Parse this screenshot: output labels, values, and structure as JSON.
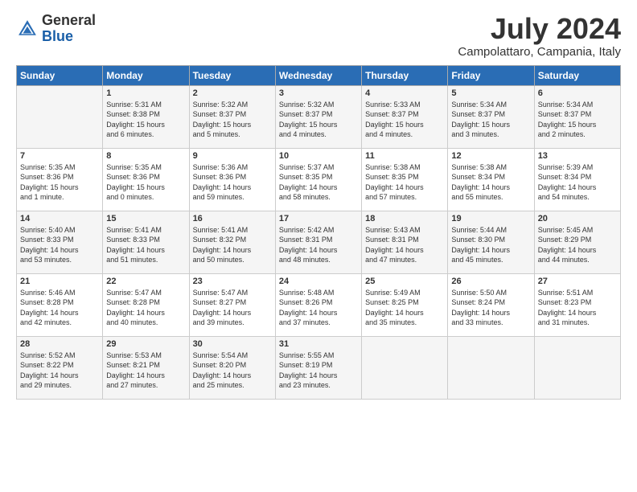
{
  "header": {
    "logo_general": "General",
    "logo_blue": "Blue",
    "month_title": "July 2024",
    "location": "Campolattaro, Campania, Italy"
  },
  "days_of_week": [
    "Sunday",
    "Monday",
    "Tuesday",
    "Wednesday",
    "Thursday",
    "Friday",
    "Saturday"
  ],
  "weeks": [
    [
      {
        "day": "",
        "lines": []
      },
      {
        "day": "1",
        "lines": [
          "Sunrise: 5:31 AM",
          "Sunset: 8:38 PM",
          "Daylight: 15 hours",
          "and 6 minutes."
        ]
      },
      {
        "day": "2",
        "lines": [
          "Sunrise: 5:32 AM",
          "Sunset: 8:37 PM",
          "Daylight: 15 hours",
          "and 5 minutes."
        ]
      },
      {
        "day": "3",
        "lines": [
          "Sunrise: 5:32 AM",
          "Sunset: 8:37 PM",
          "Daylight: 15 hours",
          "and 4 minutes."
        ]
      },
      {
        "day": "4",
        "lines": [
          "Sunrise: 5:33 AM",
          "Sunset: 8:37 PM",
          "Daylight: 15 hours",
          "and 4 minutes."
        ]
      },
      {
        "day": "5",
        "lines": [
          "Sunrise: 5:34 AM",
          "Sunset: 8:37 PM",
          "Daylight: 15 hours",
          "and 3 minutes."
        ]
      },
      {
        "day": "6",
        "lines": [
          "Sunrise: 5:34 AM",
          "Sunset: 8:37 PM",
          "Daylight: 15 hours",
          "and 2 minutes."
        ]
      }
    ],
    [
      {
        "day": "7",
        "lines": [
          "Sunrise: 5:35 AM",
          "Sunset: 8:36 PM",
          "Daylight: 15 hours",
          "and 1 minute."
        ]
      },
      {
        "day": "8",
        "lines": [
          "Sunrise: 5:35 AM",
          "Sunset: 8:36 PM",
          "Daylight: 15 hours",
          "and 0 minutes."
        ]
      },
      {
        "day": "9",
        "lines": [
          "Sunrise: 5:36 AM",
          "Sunset: 8:36 PM",
          "Daylight: 14 hours",
          "and 59 minutes."
        ]
      },
      {
        "day": "10",
        "lines": [
          "Sunrise: 5:37 AM",
          "Sunset: 8:35 PM",
          "Daylight: 14 hours",
          "and 58 minutes."
        ]
      },
      {
        "day": "11",
        "lines": [
          "Sunrise: 5:38 AM",
          "Sunset: 8:35 PM",
          "Daylight: 14 hours",
          "and 57 minutes."
        ]
      },
      {
        "day": "12",
        "lines": [
          "Sunrise: 5:38 AM",
          "Sunset: 8:34 PM",
          "Daylight: 14 hours",
          "and 55 minutes."
        ]
      },
      {
        "day": "13",
        "lines": [
          "Sunrise: 5:39 AM",
          "Sunset: 8:34 PM",
          "Daylight: 14 hours",
          "and 54 minutes."
        ]
      }
    ],
    [
      {
        "day": "14",
        "lines": [
          "Sunrise: 5:40 AM",
          "Sunset: 8:33 PM",
          "Daylight: 14 hours",
          "and 53 minutes."
        ]
      },
      {
        "day": "15",
        "lines": [
          "Sunrise: 5:41 AM",
          "Sunset: 8:33 PM",
          "Daylight: 14 hours",
          "and 51 minutes."
        ]
      },
      {
        "day": "16",
        "lines": [
          "Sunrise: 5:41 AM",
          "Sunset: 8:32 PM",
          "Daylight: 14 hours",
          "and 50 minutes."
        ]
      },
      {
        "day": "17",
        "lines": [
          "Sunrise: 5:42 AM",
          "Sunset: 8:31 PM",
          "Daylight: 14 hours",
          "and 48 minutes."
        ]
      },
      {
        "day": "18",
        "lines": [
          "Sunrise: 5:43 AM",
          "Sunset: 8:31 PM",
          "Daylight: 14 hours",
          "and 47 minutes."
        ]
      },
      {
        "day": "19",
        "lines": [
          "Sunrise: 5:44 AM",
          "Sunset: 8:30 PM",
          "Daylight: 14 hours",
          "and 45 minutes."
        ]
      },
      {
        "day": "20",
        "lines": [
          "Sunrise: 5:45 AM",
          "Sunset: 8:29 PM",
          "Daylight: 14 hours",
          "and 44 minutes."
        ]
      }
    ],
    [
      {
        "day": "21",
        "lines": [
          "Sunrise: 5:46 AM",
          "Sunset: 8:28 PM",
          "Daylight: 14 hours",
          "and 42 minutes."
        ]
      },
      {
        "day": "22",
        "lines": [
          "Sunrise: 5:47 AM",
          "Sunset: 8:28 PM",
          "Daylight: 14 hours",
          "and 40 minutes."
        ]
      },
      {
        "day": "23",
        "lines": [
          "Sunrise: 5:47 AM",
          "Sunset: 8:27 PM",
          "Daylight: 14 hours",
          "and 39 minutes."
        ]
      },
      {
        "day": "24",
        "lines": [
          "Sunrise: 5:48 AM",
          "Sunset: 8:26 PM",
          "Daylight: 14 hours",
          "and 37 minutes."
        ]
      },
      {
        "day": "25",
        "lines": [
          "Sunrise: 5:49 AM",
          "Sunset: 8:25 PM",
          "Daylight: 14 hours",
          "and 35 minutes."
        ]
      },
      {
        "day": "26",
        "lines": [
          "Sunrise: 5:50 AM",
          "Sunset: 8:24 PM",
          "Daylight: 14 hours",
          "and 33 minutes."
        ]
      },
      {
        "day": "27",
        "lines": [
          "Sunrise: 5:51 AM",
          "Sunset: 8:23 PM",
          "Daylight: 14 hours",
          "and 31 minutes."
        ]
      }
    ],
    [
      {
        "day": "28",
        "lines": [
          "Sunrise: 5:52 AM",
          "Sunset: 8:22 PM",
          "Daylight: 14 hours",
          "and 29 minutes."
        ]
      },
      {
        "day": "29",
        "lines": [
          "Sunrise: 5:53 AM",
          "Sunset: 8:21 PM",
          "Daylight: 14 hours",
          "and 27 minutes."
        ]
      },
      {
        "day": "30",
        "lines": [
          "Sunrise: 5:54 AM",
          "Sunset: 8:20 PM",
          "Daylight: 14 hours",
          "and 25 minutes."
        ]
      },
      {
        "day": "31",
        "lines": [
          "Sunrise: 5:55 AM",
          "Sunset: 8:19 PM",
          "Daylight: 14 hours",
          "and 23 minutes."
        ]
      },
      {
        "day": "",
        "lines": []
      },
      {
        "day": "",
        "lines": []
      },
      {
        "day": "",
        "lines": []
      }
    ]
  ]
}
